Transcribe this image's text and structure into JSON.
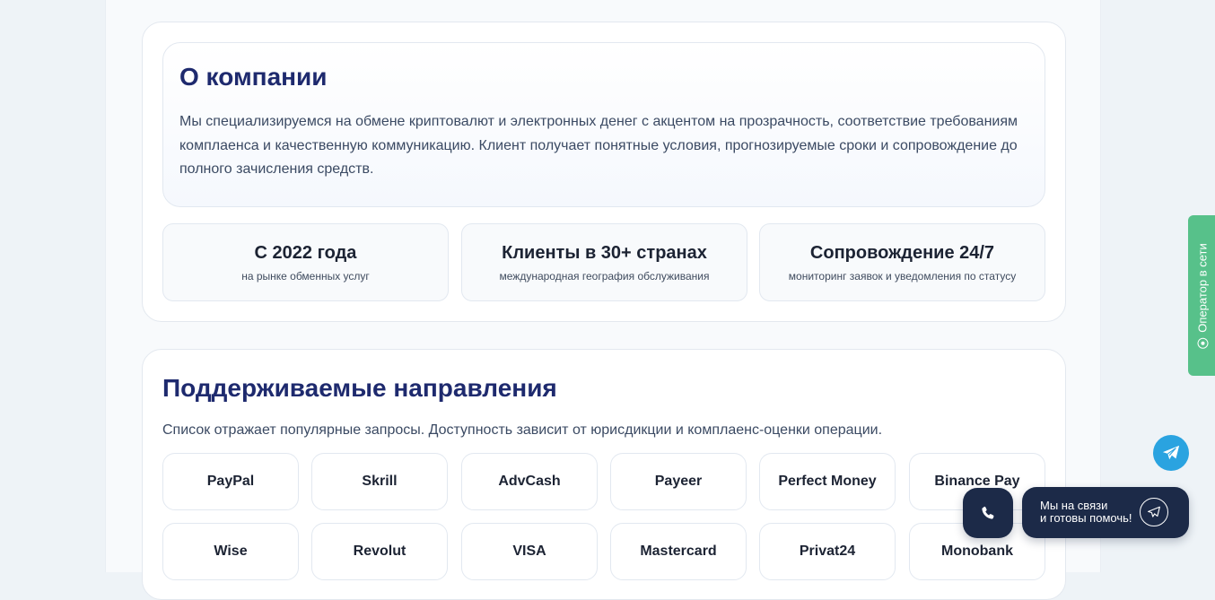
{
  "about": {
    "title": "О компании",
    "text": "Мы специализируемся на обмене криптовалют и электронных денег с акцентом на прозрачность, соответствие требованиям комплаенса и качественную коммуникацию. Клиент получает понятные условия, прогнозируемые сроки и сопровождение до полного зачисления средств."
  },
  "stats": [
    {
      "title": "С 2022 года",
      "subtitle": "на рынке обменных услуг"
    },
    {
      "title": "Клиенты в 30+ странах",
      "subtitle": "международная география обслуживания"
    },
    {
      "title": "Сопровождение 24/7",
      "subtitle": "мониторинг заявок и уведомления по статусу"
    }
  ],
  "directions": {
    "title": "Поддерживаемые направления",
    "description": "Список отражает популярные запросы. Доступность зависит от юрисдикции и комплаенс-оценки операции.",
    "items": [
      "PayPal",
      "Skrill",
      "AdvCash",
      "Payeer",
      "Perfect Money",
      "Binance Pay",
      "Wise",
      "Revolut",
      "VISA",
      "Mastercard",
      "Privat24",
      "Monobank"
    ]
  },
  "widgets": {
    "operator_label": "Оператор в сети",
    "chat_line1": "Мы на связи",
    "chat_line2": "и готовы помочь!",
    "icons": [
      "phone-icon",
      "telegram-icon",
      "online-dot-icon"
    ],
    "colors": {
      "operator": "#57c18a",
      "telegram": "#2aa3e0",
      "chat_bg": "#1c2a48",
      "heading": "#1e2a6e"
    }
  }
}
